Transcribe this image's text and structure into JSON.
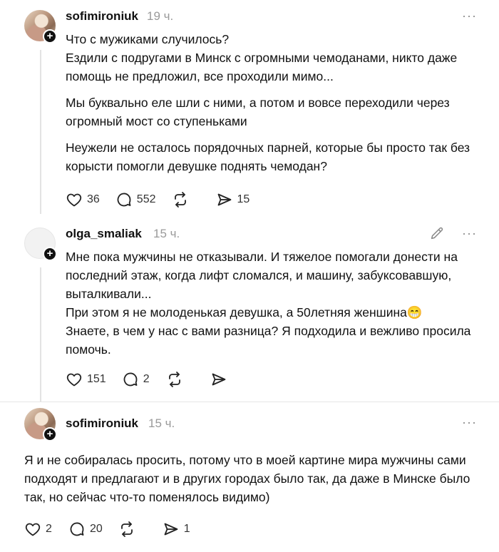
{
  "posts": [
    {
      "username": "sofimironiuk",
      "time": "19 ч.",
      "paragraphs": [
        "Что с мужиками случилось?\nЕздили с подругами в Минск с огромными чемоданами, никто даже помощь не предложил, все проходили мимо...",
        "Мы буквально еле шли с ними, а потом и вовсе переходили через огромный мост со ступеньками",
        "Неужели не осталось порядочных парней, которые бы просто так без корысти помогли девушке поднять чемодан?"
      ],
      "likes": "36",
      "comments": "552",
      "reposts": "",
      "shares": "15"
    },
    {
      "username": "olga_smaliak",
      "time": "15 ч.",
      "paragraphs": [
        "Мне пока мужчины не отказывали. И тяжелое помогали донести на последний этаж, когда лифт сломался, и машину, забуксовавшую, выталкивали...\nПри этом я не молоденькая девушка, а 50летняя женшина😁\nЗнаете, в чем у нас с вами разница? Я подходила и вежливо просила помочь."
      ],
      "likes": "151",
      "comments": "2",
      "reposts": "",
      "shares": ""
    },
    {
      "username": "sofimironiuk",
      "time": "15 ч.",
      "paragraphs": [
        "Я и не собиралась просить, потому что в моей картине мира мужчины сами подходят и предлагают и в других городах было так, да даже в Минске было так, но сейчас что-то поменялось видимо)"
      ],
      "likes": "2",
      "comments": "20",
      "reposts": "",
      "shares": "1"
    }
  ],
  "icons": {
    "like": "heart-icon",
    "comment": "comment-bubble-icon",
    "repost": "repost-icon",
    "share": "send-icon",
    "more": "more-options-icon",
    "edit": "pencil-icon",
    "follow": "plus-icon"
  },
  "more_glyph": "···",
  "follow_glyph": "+"
}
